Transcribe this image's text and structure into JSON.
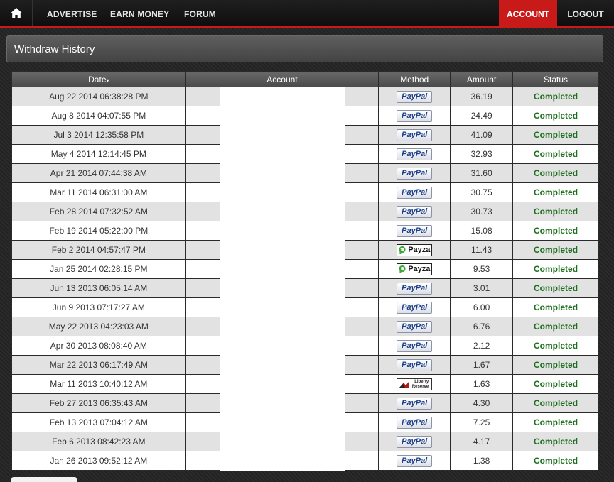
{
  "nav": {
    "home_icon": "home-icon",
    "links": [
      "ADVERTISE",
      "EARN MONEY",
      "FORUM"
    ],
    "account": "ACCOUNT",
    "logout": "LOGOUT",
    "accent_color": "#c91a1a"
  },
  "panel": {
    "title": "Withdraw History"
  },
  "table": {
    "columns": {
      "date": "Date",
      "account": "Account",
      "method": "Method",
      "amount": "Amount",
      "status": "Status"
    },
    "sort_indicator": "▾",
    "rows": [
      {
        "date": "Aug 22 2014 06:38:28 PM",
        "method": "PayPal",
        "amount": "36.19",
        "status": "Completed"
      },
      {
        "date": "Aug 8 2014 04:07:55 PM",
        "method": "PayPal",
        "amount": "24.49",
        "status": "Completed"
      },
      {
        "date": "Jul 3 2014 12:35:58 PM",
        "method": "PayPal",
        "amount": "41.09",
        "status": "Completed"
      },
      {
        "date": "May 4 2014 12:14:45 PM",
        "method": "PayPal",
        "amount": "32.93",
        "status": "Completed"
      },
      {
        "date": "Apr 21 2014 07:44:38 AM",
        "method": "PayPal",
        "amount": "31.60",
        "status": "Completed"
      },
      {
        "date": "Mar 11 2014 06:31:00 AM",
        "method": "PayPal",
        "amount": "30.75",
        "status": "Completed"
      },
      {
        "date": "Feb 28 2014 07:32:52 AM",
        "method": "PayPal",
        "amount": "30.73",
        "status": "Completed"
      },
      {
        "date": "Feb 19 2014 05:22:00 PM",
        "method": "PayPal",
        "amount": "15.08",
        "status": "Completed"
      },
      {
        "date": "Feb 2 2014 04:57:47 PM",
        "method": "Payza",
        "amount": "11.43",
        "status": "Completed"
      },
      {
        "date": "Jan 25 2014 02:28:15 PM",
        "method": "Payza",
        "amount": "9.53",
        "status": "Completed"
      },
      {
        "date": "Jun 13 2013 06:05:14 AM",
        "method": "PayPal",
        "amount": "3.01",
        "status": "Completed"
      },
      {
        "date": "Jun 9 2013 07:17:27 AM",
        "method": "PayPal",
        "amount": "6.00",
        "status": "Completed"
      },
      {
        "date": "May 22 2013 04:23:03 AM",
        "method": "PayPal",
        "amount": "6.76",
        "status": "Completed"
      },
      {
        "date": "Apr 30 2013 08:08:40 AM",
        "method": "PayPal",
        "amount": "2.12",
        "status": "Completed"
      },
      {
        "date": "Mar 22 2013 06:17:49 AM",
        "method": "PayPal",
        "amount": "1.67",
        "status": "Completed"
      },
      {
        "date": "Mar 11 2013 10:40:12 AM",
        "method": "Liberty Reserve",
        "amount": "1.63",
        "status": "Completed"
      },
      {
        "date": "Feb 27 2013 06:35:43 AM",
        "method": "PayPal",
        "amount": "4.30",
        "status": "Completed"
      },
      {
        "date": "Feb 13 2013 07:04:12 AM",
        "method": "PayPal",
        "amount": "7.25",
        "status": "Completed"
      },
      {
        "date": "Feb 6 2013 08:42:23 AM",
        "method": "PayPal",
        "amount": "4.17",
        "status": "Completed"
      },
      {
        "date": "Jan 26 2013 09:52:12 AM",
        "method": "PayPal",
        "amount": "1.38",
        "status": "Completed"
      }
    ]
  },
  "colors": {
    "status_completed": "#1d6e1d",
    "paypal_text": "#1d3f8a",
    "payza_green": "#3aa935"
  }
}
